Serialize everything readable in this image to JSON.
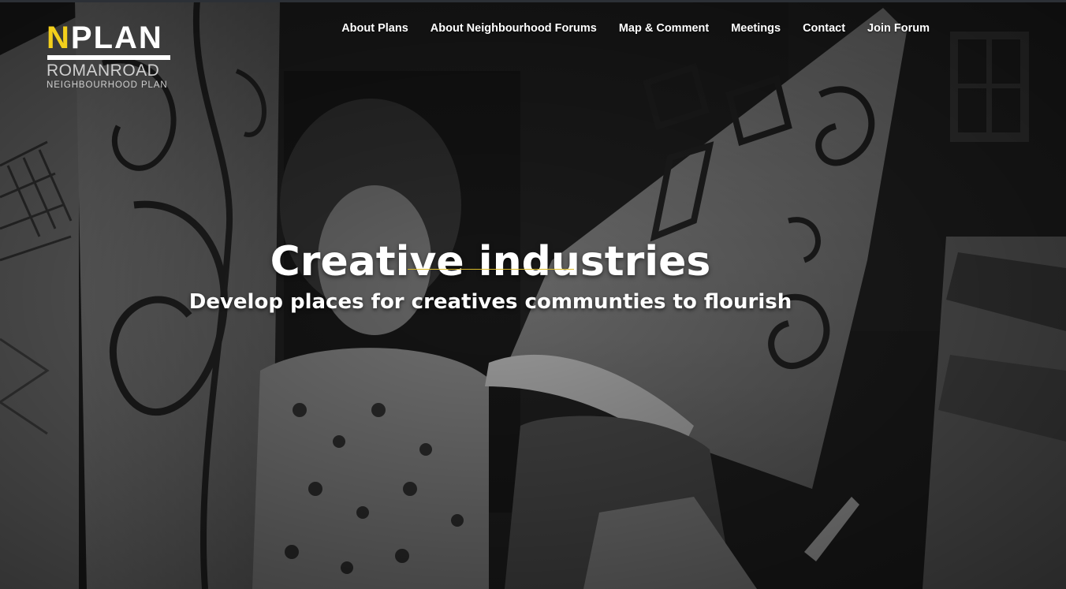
{
  "logo": {
    "word_first": "N",
    "word_rest": "PLAN",
    "line1": "ROMANROAD",
    "line2": "NEIGHBOURHOOD PLAN",
    "accent_color": "#f3cf1b"
  },
  "nav": {
    "items": [
      {
        "label": "About Plans"
      },
      {
        "label": "About Neighbourhood Forums"
      },
      {
        "label": "Map & Comment"
      },
      {
        "label": "Meetings"
      },
      {
        "label": "Contact"
      },
      {
        "label": "Join Forum"
      }
    ]
  },
  "hero": {
    "title": "Creative industries",
    "subtitle": "Develop places for creatives communties to flourish",
    "divider_color": "#d9ba2a",
    "background_image": "black-and-white-photo-people-drawing-hanging-artworks"
  }
}
